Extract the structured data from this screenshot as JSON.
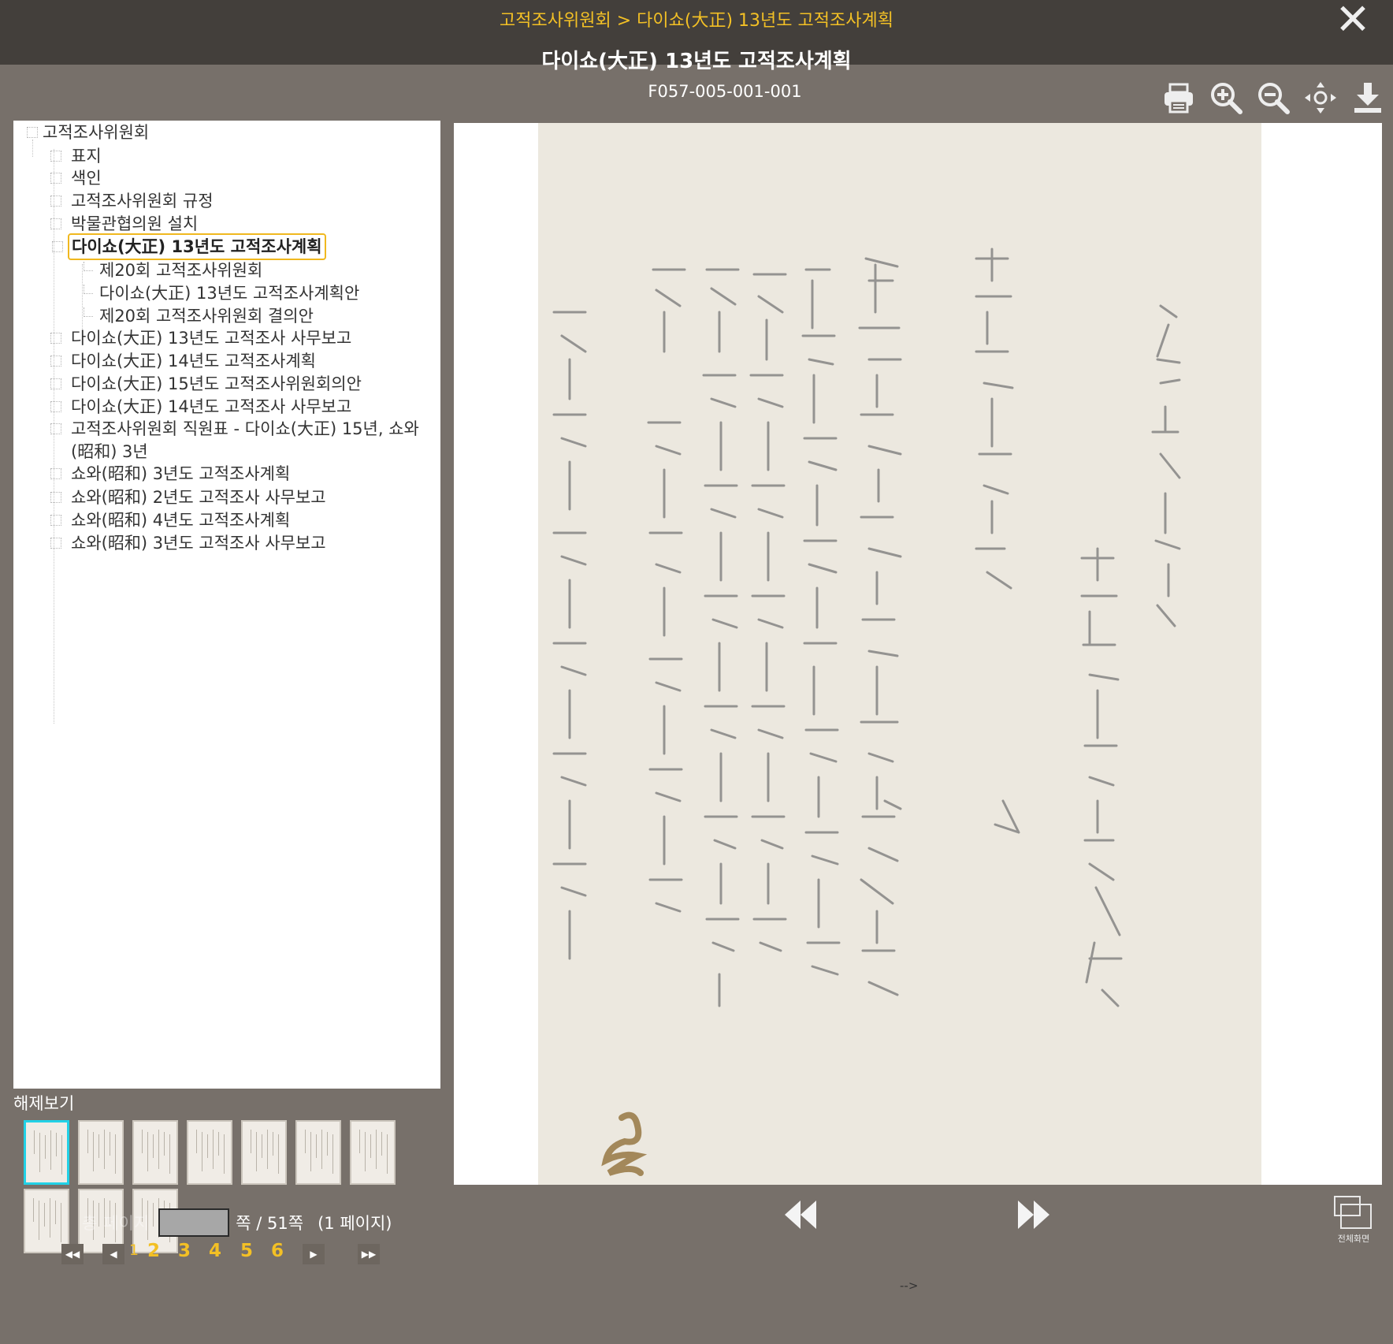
{
  "header": {
    "breadcrumb": "고적조사위원회 > 다이쇼(大正) 13년도 고적조사계획",
    "title": "다이쇼(大正) 13년도 고적조사계획",
    "code": "F057-005-001-001",
    "close_icon": "close-icon"
  },
  "toolbar": {
    "items": [
      {
        "name": "print",
        "icon": "printer-icon"
      },
      {
        "name": "zoom-in",
        "icon": "zoom-in-icon"
      },
      {
        "name": "zoom-out",
        "icon": "zoom-out-icon"
      },
      {
        "name": "fit",
        "icon": "fit-screen-icon"
      },
      {
        "name": "download",
        "icon": "download-icon"
      }
    ]
  },
  "tree": {
    "root": "고적조사위원회",
    "items": [
      {
        "label": "표지"
      },
      {
        "label": "색인"
      },
      {
        "label": "고적조사위원회 규정"
      },
      {
        "label": "박물관협의원 설치"
      },
      {
        "label": "다이쇼(大正) 13년도 고적조사계획",
        "selected": true
      },
      {
        "label": "제20회 고적조사위원회",
        "child": true
      },
      {
        "label": "다이쇼(大正) 13년도 고적조사계획안",
        "child": true
      },
      {
        "label": "제20회 고적조사위원회 결의안",
        "child": true
      },
      {
        "label": "다이쇼(大正) 13년도 고적조사 사무보고"
      },
      {
        "label": "다이쇼(大正) 14년도 고적조사계획"
      },
      {
        "label": "다이쇼(大正) 15년도 고적조사위원회의안"
      },
      {
        "label": "다이쇼(大正) 14년도 고적조사 사무보고"
      },
      {
        "label": "고적조사위원회 직원표 - 다이쇼(大正) 15년, 쇼와"
      },
      {
        "label": "(昭和) 3년",
        "continuation": true
      },
      {
        "label": "쇼와(昭和) 3년도 고적조사계획"
      },
      {
        "label": "쇼와(昭和) 2년도 고적조사 사무보고"
      },
      {
        "label": "쇼와(昭和) 4년도 고적조사계획"
      },
      {
        "label": "쇼와(昭和) 3년도 고적조사 사무보고"
      }
    ]
  },
  "haeje_label": "해제보기",
  "thumbnails": {
    "count": 10,
    "active_index": 0
  },
  "paging": {
    "page_prefix": "총",
    "page_word": "페이지",
    "page_input_value": "",
    "page_suffix": "쪽 / 51쪽",
    "page_info": "(1 페이지)",
    "current": "1",
    "pages": [
      "2",
      "3",
      "4",
      "5",
      "6"
    ]
  },
  "nav": {
    "prev_icon": "rewind-icon",
    "next_icon": "fast-forward-icon"
  },
  "fullscreen": {
    "label": "전체화면",
    "icon": "fullscreen-icon"
  },
  "stray_text": "-->",
  "colors": {
    "accent": "#f3c025",
    "topbar": "#433f3b",
    "background": "#77706a",
    "selected_border": "#f0b81f",
    "active_thumb": "#22d1e6"
  }
}
